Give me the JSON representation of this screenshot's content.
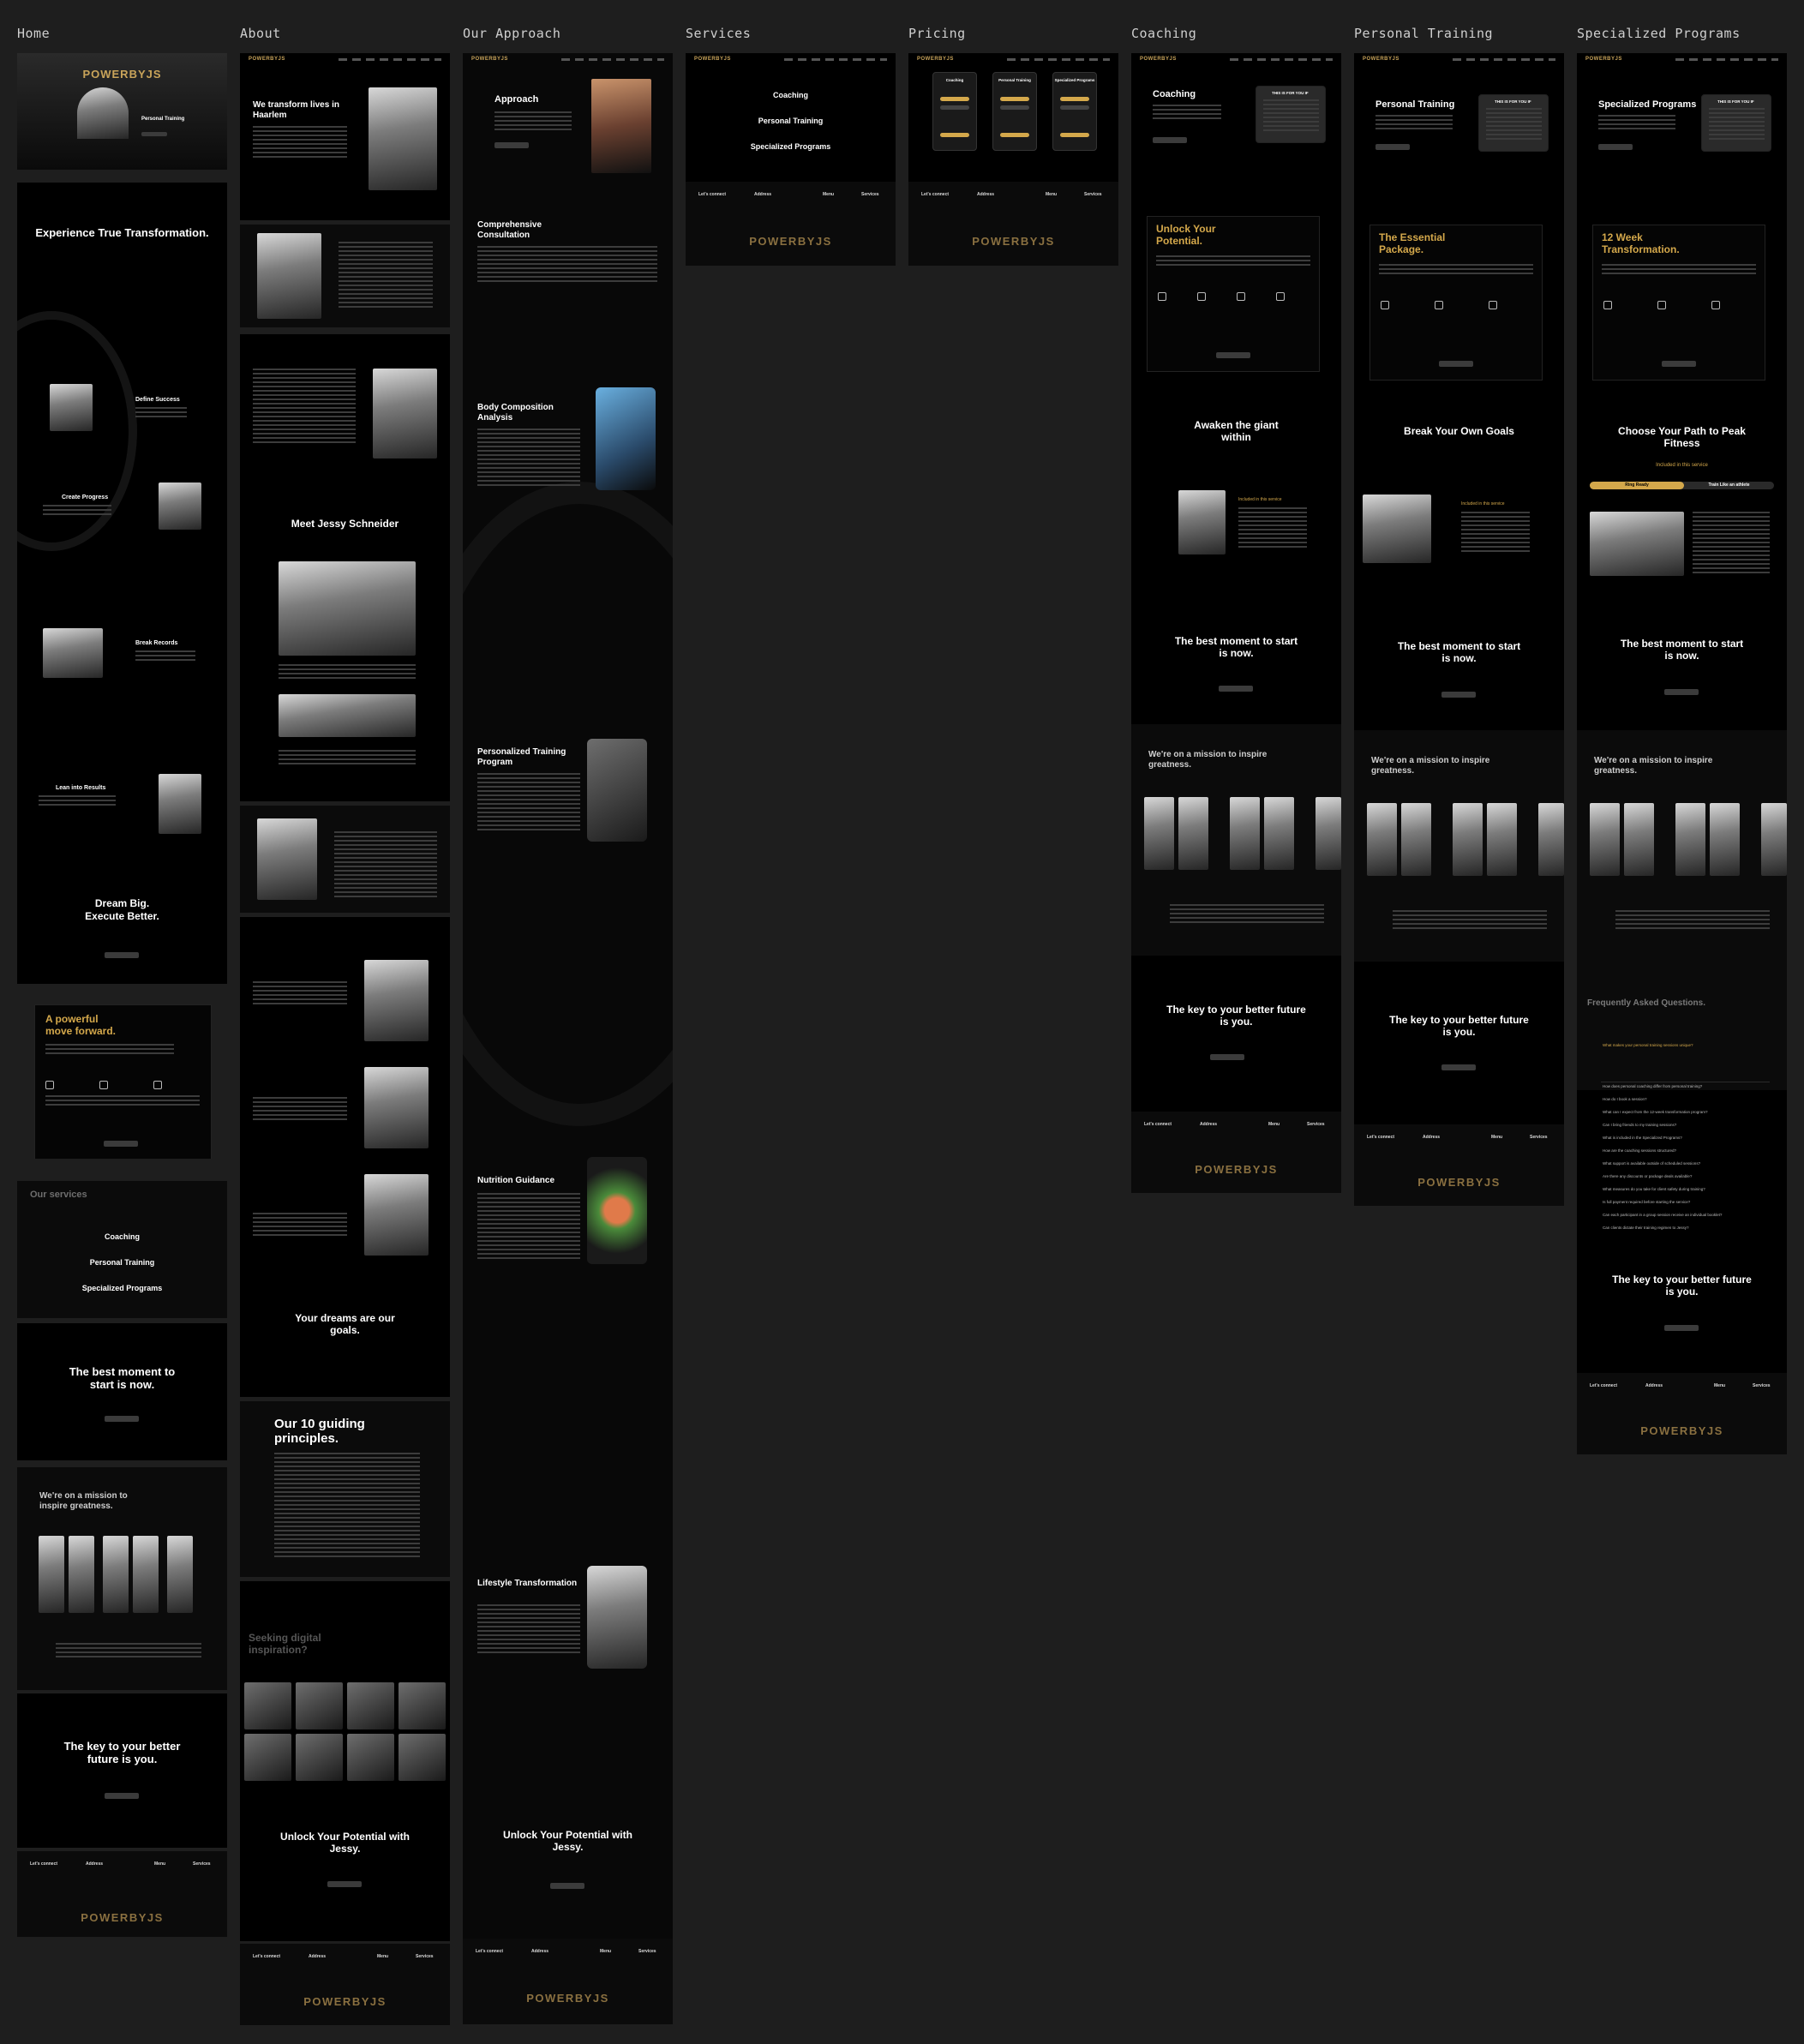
{
  "columns": {
    "home": "Home",
    "about": "About",
    "approach": "Our Approach",
    "services": "Services",
    "pricing": "Pricing",
    "coaching": "Coaching",
    "personal_training": "Personal Training",
    "specialized": "Specialized Programs"
  },
  "brand": "POWERBYJS",
  "home": {
    "hero_logo": "POWERBYJS",
    "hero_sub": "Personal Training",
    "experience": "Experience True Transformation.",
    "steps": [
      "Define Success",
      "Create Progress",
      "Break Records",
      "Lean into Results"
    ],
    "dream1": "Dream Big.",
    "dream2": "Execute Better.",
    "powerful1": "A powerful",
    "powerful2": "move forward.",
    "our_services": "Our services",
    "services": [
      "Coaching",
      "Personal Training",
      "Specialized Programs"
    ],
    "best_moment": "The best moment to start is now.",
    "mission": "We're on a mission to inspire greatness.",
    "key": "The key to your better future is you.",
    "footer": {
      "connect": "Let's connect",
      "address": "Address",
      "menu": "Menu",
      "services": "Services"
    }
  },
  "about": {
    "transform": "We transform lives in Haarlem",
    "meet": "Meet Jessy Schneider",
    "dreams": "Your dreams are our goals.",
    "principles": "Our 10 guiding principles.",
    "seeking": "Seeking digital inspiration?",
    "unlock": "Unlock Your Potential with Jessy."
  },
  "approach": {
    "title": "Approach",
    "sections": [
      "Comprehensive Consultation",
      "Body Composition Analysis",
      "Personalized Training Program",
      "Nutrition Guidance",
      "Lifestyle Transformation"
    ],
    "unlock": "Unlock Your Potential with Jessy."
  },
  "services_page": {
    "items": [
      "Coaching",
      "Personal Training",
      "Specialized Programs"
    ],
    "footer_connect": "Let's connect",
    "footer_address": "Address",
    "footer_menu": "Menu",
    "footer_services": "Services"
  },
  "pricing": {
    "cards": [
      "Coaching",
      "Personal Training",
      "Specialized Programs"
    ]
  },
  "coaching": {
    "title": "Coaching",
    "for_you": "THIS IS FOR YOU IF",
    "unlock1": "Unlock Your",
    "unlock2": "Potential.",
    "awaken": "Awaken the giant within",
    "included": "Included in this service",
    "best_moment": "The best moment to start is now.",
    "mission": "We're on a mission to inspire greatness.",
    "key": "The key to your better future is you."
  },
  "personal": {
    "title": "Personal Training",
    "for_you": "THIS IS FOR YOU IF",
    "essential1": "The Essential",
    "essential2": "Package.",
    "break": "Break Your Own Goals",
    "included": "Included in this service",
    "best_moment": "The best moment to start is now.",
    "mission": "We're on a mission to inspire greatness.",
    "key": "The key to your better future is you."
  },
  "specialized": {
    "title": "Specialized Programs",
    "for_you": "THIS IS FOR YOU IF",
    "week1": "12 Week",
    "week2": "Transformation.",
    "choose": "Choose Your Path to Peak Fitness",
    "included": "Included in this service",
    "tab1": "Ring Ready",
    "tab2": "Train Like an athlete",
    "best_moment": "The best moment to start is now.",
    "mission": "We're on a mission to inspire greatness.",
    "faq_title": "Frequently Asked Questions.",
    "faq": [
      "What makes your personal training sessions unique?",
      "How does personal coaching differ from personal training?",
      "How do I book a session?",
      "What can I expect from the 12-week transformation program?",
      "Can I bring friends to my training sessions?",
      "What is included in the Specialized Programs?",
      "How are the coaching sessions structured?",
      "What support is available outside of scheduled sessions?",
      "Are there any discounts or package deals available?",
      "What measures do you take for client safety during training?",
      "Is full payment required before starting the service?",
      "Can each participant in a group session receive an individual booklet?",
      "Can clients dictate their training regimen to Jessy?"
    ],
    "key": "The key to your better future is you."
  },
  "colors": {
    "background": "#1e1e1e",
    "page": "#000000",
    "accent": "#d4a84b"
  }
}
